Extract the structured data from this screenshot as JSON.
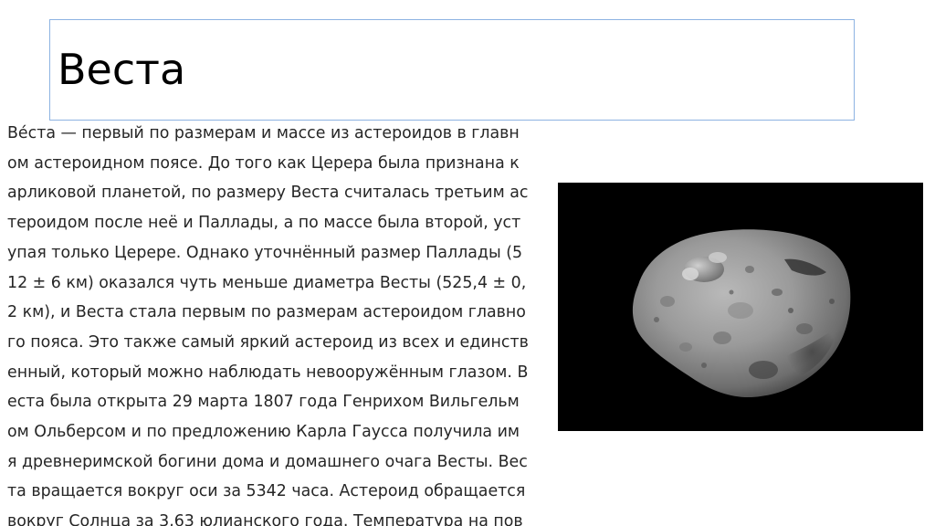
{
  "slide": {
    "title": "Веста",
    "body_lines": [
      "Ве́ста — первый по размерам и массе из астероидов в главн",
      "ом астероидном поясе. До того как Церера была признана к",
      "арликовой планетой, по размеру Веста считалась третьим ас",
      "тероидом после неё и Паллады, а по массе была второй, уст",
      "упая только Церере. Однако уточнённый размер Паллады (5",
      "12 ± 6 км) оказался чуть меньше диаметра Весты (525,4 ± 0,",
      "2 км), и Веста стала первым по размерам астероидом главно",
      "го пояса. Это также самый яркий астероид из всех и единств",
      "енный, который можно наблюдать невооружённым глазом. В",
      "еста была открыта 29 марта 1807 года Генрихом Вильгельм",
      "ом Ольберсом и по предложению Карла Гаусса получила им",
      "я древнеримской богини дома и домашнего очага Весты. Вес",
      "та вращается вокруг оси за 5342 часа. Астероид обращается",
      "вокруг Солнца за 3,63 юлианского года. Температура на пов"
    ],
    "image": {
      "subject": "asteroid-vesta-photo",
      "background_color": "#000000"
    }
  },
  "colors": {
    "title_border": "#8db3e2",
    "text": "#262626",
    "title_text": "#000000"
  }
}
